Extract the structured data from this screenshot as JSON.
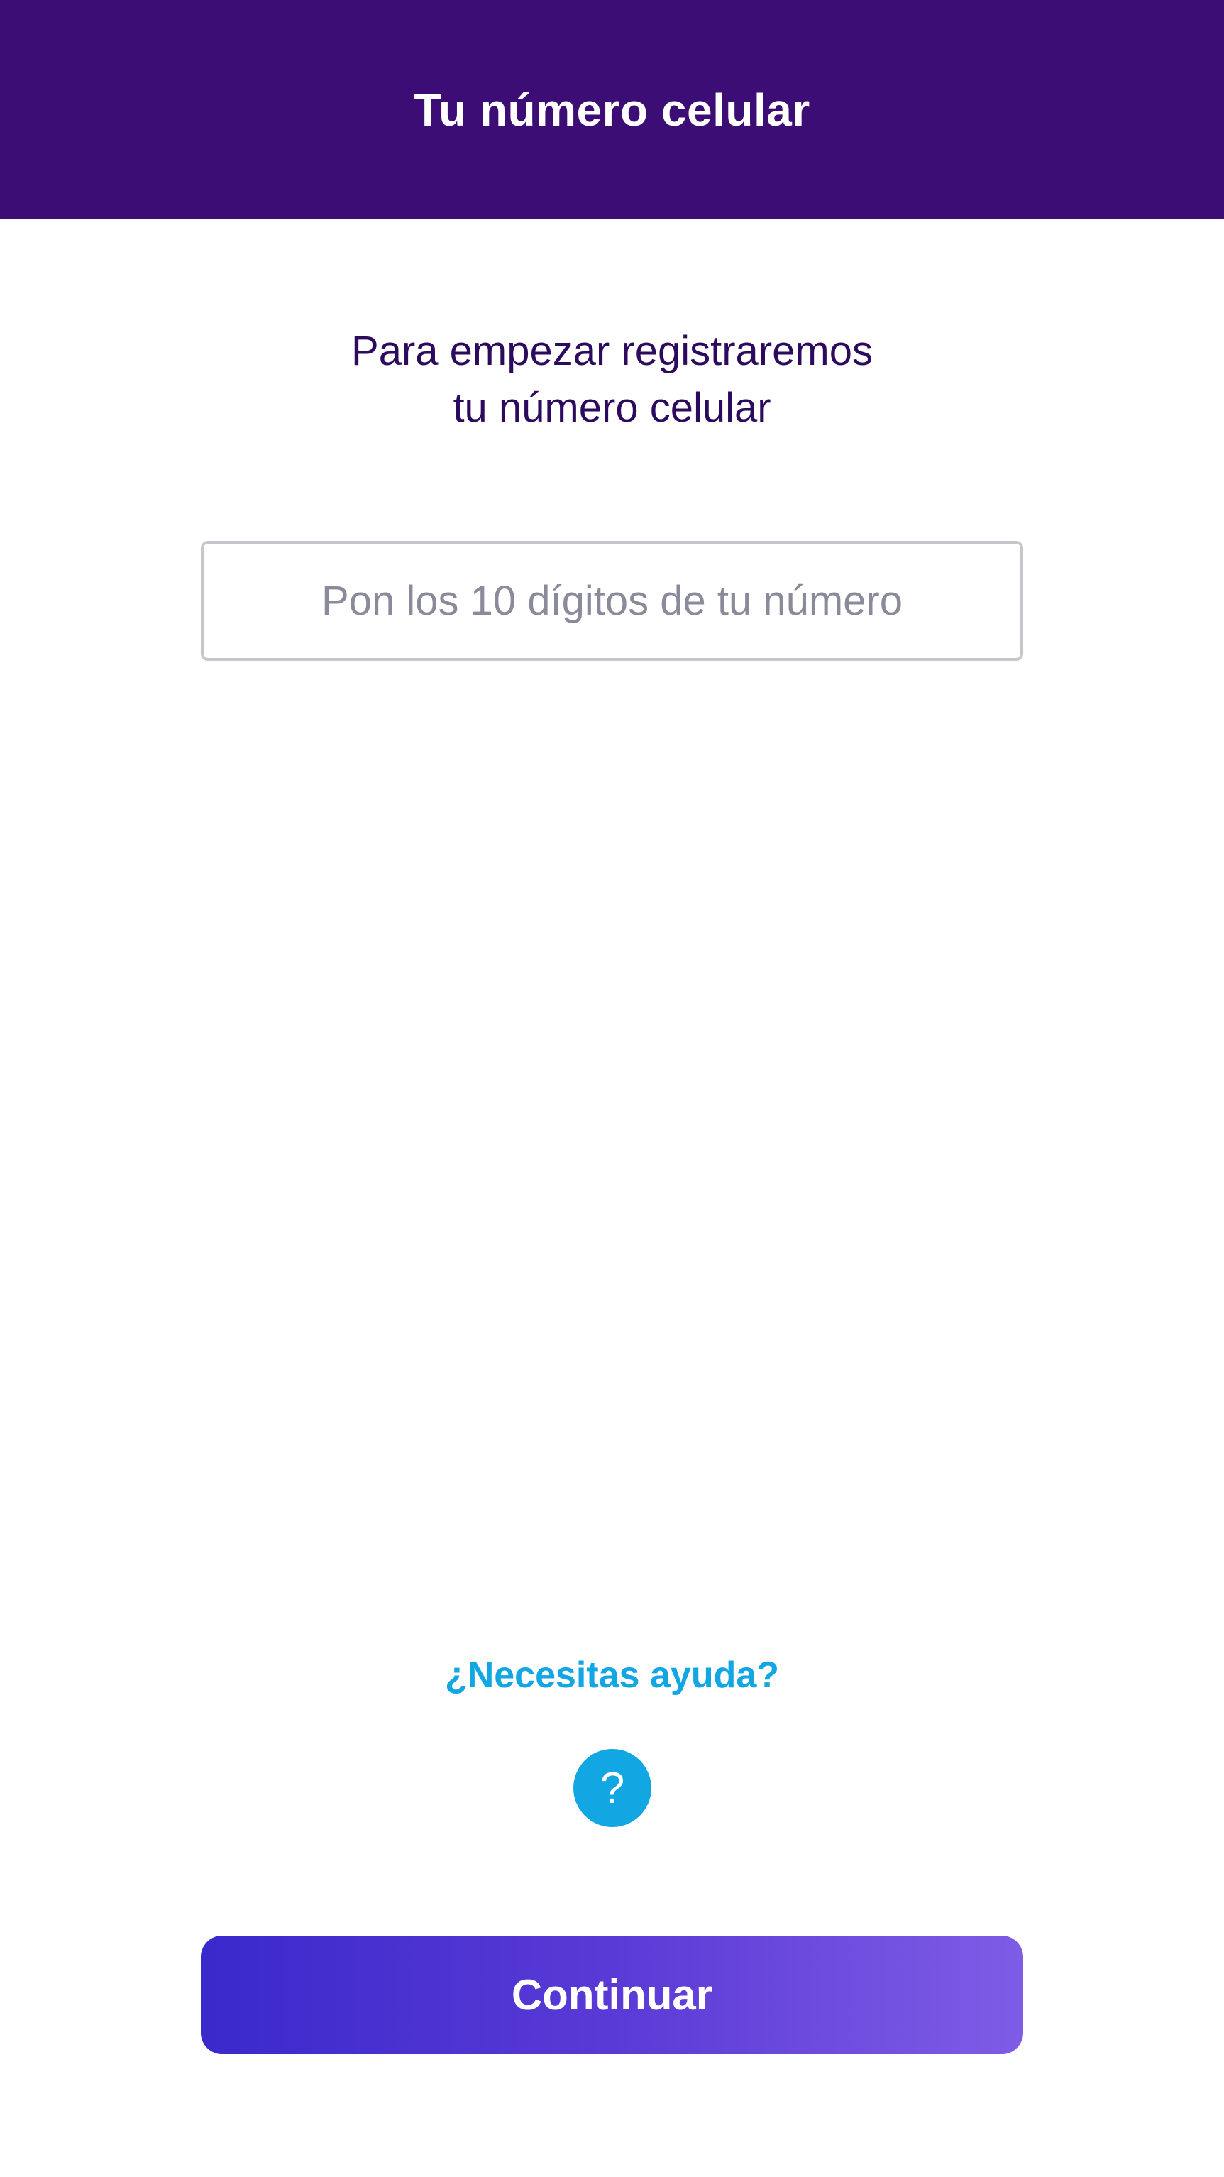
{
  "header": {
    "title": "Tu número celular"
  },
  "intro": {
    "line1": "Para empezar registraremos",
    "line2": "tu número celular"
  },
  "phone_input": {
    "value": "",
    "placeholder": "Pon los 10 dígitos de tu número"
  },
  "help": {
    "link_label": "¿Necesitas ayuda?",
    "icon_glyph": "?",
    "icon": "question-circle-icon"
  },
  "continue_button": {
    "label": "Continuar"
  },
  "colors": {
    "header_bg": "#3b0d75",
    "intro_text": "#2c0a5e",
    "help_accent": "#12a6e3",
    "button_gradient_start": "#3a29cb",
    "button_gradient_end": "#7f5ce6"
  }
}
